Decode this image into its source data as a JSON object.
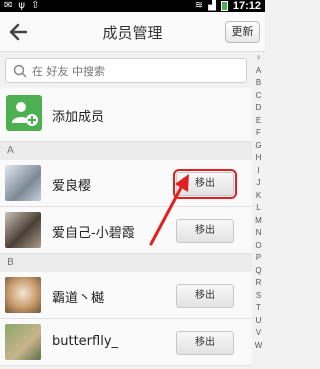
{
  "status_bar": {
    "time": "17:12"
  },
  "header": {
    "title": "成员管理",
    "refresh_label": "更新"
  },
  "search": {
    "placeholder": "在 好友 中搜索"
  },
  "add_member": {
    "label": "添加成员"
  },
  "sections": [
    {
      "letter": "A",
      "members": [
        {
          "name": "爱良樱",
          "action": "移出",
          "highlighted": true
        },
        {
          "name": "爱自己-小碧霞",
          "action": "移出",
          "highlighted": false
        }
      ]
    },
    {
      "letter": "B",
      "members": [
        {
          "name": "霸道丶樾",
          "action": "移出",
          "highlighted": false
        },
        {
          "name": "butterflly_",
          "action": "移出",
          "highlighted": false
        }
      ]
    }
  ],
  "index_letters": [
    "♀",
    "A",
    "B",
    "C",
    "D",
    "E",
    "F",
    "G",
    "H",
    "I",
    "J",
    "K",
    "L",
    "M",
    "N",
    "O",
    "P",
    "Q",
    "R",
    "S",
    "T",
    "U",
    "V",
    "W"
  ],
  "colors": {
    "highlight_red": "#e02020",
    "add_green": "#4caf50"
  }
}
